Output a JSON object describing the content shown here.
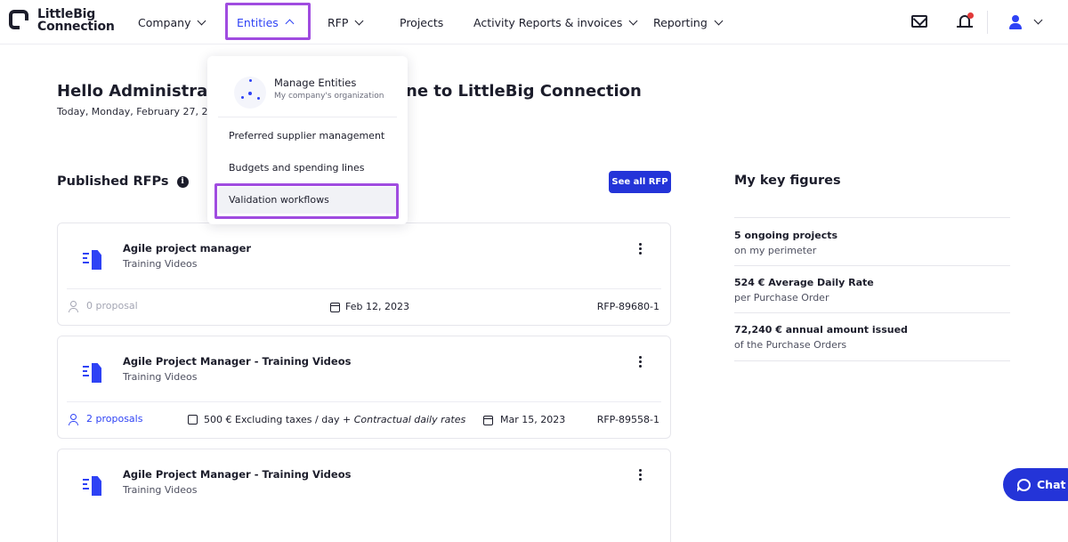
{
  "brand": {
    "name_line1": "LittleBig",
    "name_line2": "Connection"
  },
  "nav": {
    "items": [
      {
        "label": "Company"
      },
      {
        "label": "Entities"
      },
      {
        "label": "RFP"
      },
      {
        "label": "Projects"
      },
      {
        "label": "Activity Reports & invoices"
      },
      {
        "label": "Reporting"
      }
    ]
  },
  "header_icons": [
    "mail-icon",
    "bell-icon",
    "user-icon"
  ],
  "greeting": {
    "title_start": "Hello Administrato",
    "title_end": "ne to LittleBig Connection",
    "date": "Today, Monday, February 27, 202"
  },
  "dropdown": {
    "main": {
      "title": "Manage Entities",
      "subtitle": "My company's organization"
    },
    "items": [
      {
        "label": "Preferred supplier management"
      },
      {
        "label": "Budgets and spending lines"
      },
      {
        "label": "Validation workflows"
      }
    ]
  },
  "rfps": {
    "title": "Published RFPs",
    "see_all": "See all RFP",
    "cards": [
      {
        "title": "Agile project manager",
        "subtitle": "Training Videos",
        "proposals": "0 proposal",
        "date": "Feb 12, 2023",
        "ref": "RFP-89680-1"
      },
      {
        "title": "Agile Project Manager - Training Videos",
        "subtitle": "Training Videos",
        "proposals": "2 proposals",
        "rate": "500 € Excluding taxes / day",
        "rate_extra": "+ Contractual daily rates",
        "date": "Mar 15, 2023",
        "ref": "RFP-89558-1"
      },
      {
        "title": "Agile Project Manager - Training Videos",
        "subtitle": "Training Videos"
      }
    ]
  },
  "key_figures": {
    "title": "My key figures",
    "items": [
      {
        "value": "5 ongoing projects",
        "label": "on my perimeter"
      },
      {
        "value": "524 € Average Daily Rate",
        "label": "per Purchase Order"
      },
      {
        "value": "72,240 € annual amount issued",
        "label": "of the Purchase Orders"
      }
    ]
  },
  "chat": {
    "label": "Chat"
  },
  "colors": {
    "accent": "#2e42f5",
    "highlight": "#a04ce0",
    "button": "#2434d8"
  }
}
